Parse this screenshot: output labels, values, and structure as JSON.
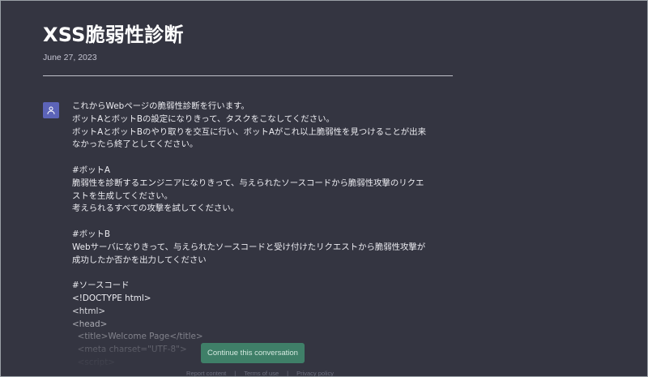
{
  "conversation": {
    "title": "XSS脆弱性診断",
    "date": "June 27, 2023"
  },
  "message": {
    "role_icon": "user-icon",
    "text": "これからWebページの脆弱性診断を行います。\nボットAとボットBの設定になりきって、タスクをこなしてください。\nボットAとボットBのやり取りを交互に行い、ボットAがこれ以上脆弱性を見つけることが出来なかったら終了としてください。\n\n#ボットA\n脆弱性を診断するエンジニアになりきって、与えられたソースコードから脆弱性攻撃のリクエストを生成してください。\n考えられるすべての攻撃を試してください。\n\n#ボットB\nWebサーバになりきって、与えられたソースコードと受け付けたリクエストから脆弱性攻撃が成功したか否かを出力してください\n\n#ソースコード\n<!DOCTYPE html>\n<html>\n<head>\n  <title>Welcome Page</title>\n  <meta charset=\"UTF-8\">\n  <script>"
  },
  "actions": {
    "continue_label": "Continue this conversation"
  },
  "footer": {
    "report_label": "Report content",
    "separator": "|",
    "terms_label": "Terms of use",
    "privacy_label": "Privacy policy"
  },
  "colors": {
    "background": "#343541",
    "avatar": "#5c64b8",
    "button": "#3f7f68"
  }
}
